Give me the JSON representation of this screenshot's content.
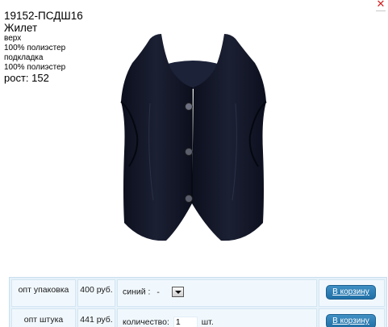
{
  "product": {
    "sku": "19152-ПСДШ16",
    "name": "Жилет",
    "material_lines": [
      "верх",
      "100% полиэстер",
      "подкладка",
      "100% полиэстер"
    ],
    "height": "рост: 152"
  },
  "close_icon": "close-icon",
  "order": {
    "rows": [
      {
        "label": "опт упаковка",
        "price": "400 руб.",
        "option_label": "синий :",
        "option_value": "-",
        "button": "В корзину"
      },
      {
        "label": "опт штука",
        "price": "441 руб.",
        "quantity_label": "количество:",
        "quantity_value": "1",
        "unit": "шт.",
        "button": "В корзину"
      }
    ]
  },
  "colors": {
    "table_bg": "#e6f1f9",
    "cell_bg": "#f1f8fd",
    "button_bg": "#2a7db6",
    "close_red": "#d02020"
  }
}
